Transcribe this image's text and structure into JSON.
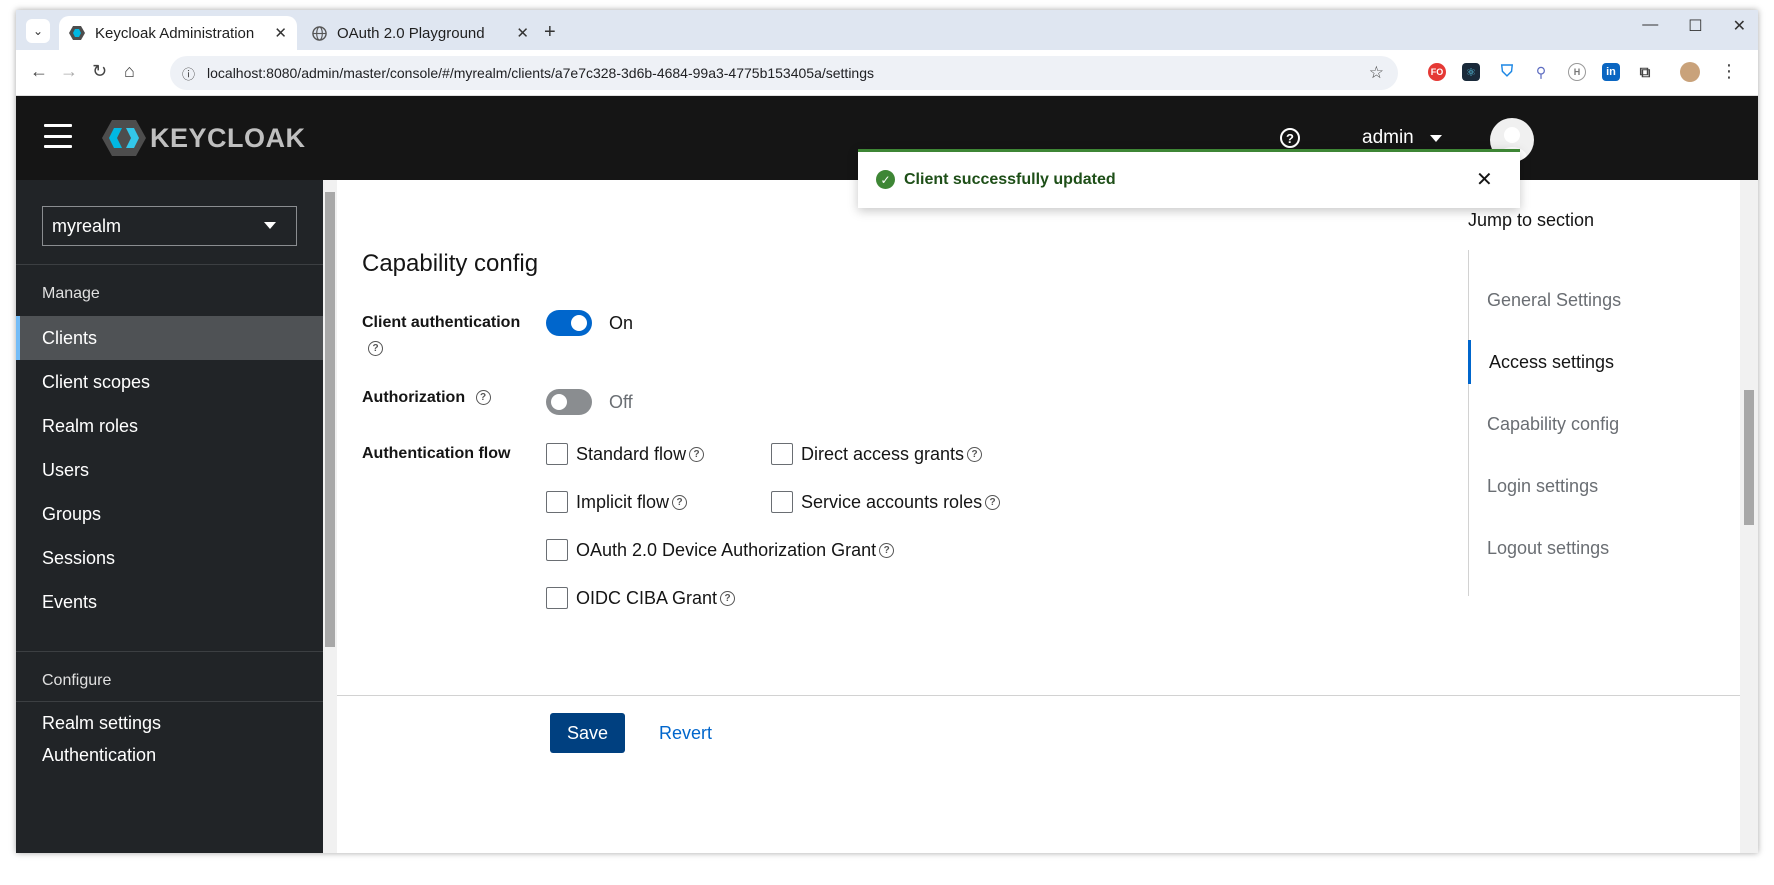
{
  "browser": {
    "tabs": [
      {
        "title": "Keycloak Administration",
        "active": true
      },
      {
        "title": "OAuth 2.0 Playground",
        "active": false
      }
    ],
    "url": "localhost:8080/admin/master/console/#/myrealm/clients/a7e7c328-3d6b-4684-99a3-4775b153405a/settings",
    "extensions": [
      "FO",
      "react-icon",
      "shield-icon",
      "share-icon",
      "H",
      "in",
      "puzzle-icon"
    ]
  },
  "header": {
    "logo": "KEYCLOAK",
    "user": "admin"
  },
  "sidebar": {
    "realm": "myrealm",
    "manage_label": "Manage",
    "items": [
      {
        "label": "Clients",
        "active": true
      },
      {
        "label": "Client scopes"
      },
      {
        "label": "Realm roles"
      },
      {
        "label": "Users"
      },
      {
        "label": "Groups"
      },
      {
        "label": "Sessions"
      },
      {
        "label": "Events"
      }
    ],
    "configure_label": "Configure",
    "configure_items": [
      {
        "label": "Realm settings"
      },
      {
        "label": "Authentication"
      }
    ]
  },
  "main": {
    "section_title": "Capability config",
    "client_auth": {
      "label": "Client authentication",
      "state": "On"
    },
    "authorization": {
      "label": "Authorization",
      "state": "Off"
    },
    "auth_flow": {
      "label": "Authentication flow",
      "options": [
        {
          "label": "Standard flow",
          "checked": false
        },
        {
          "label": "Direct access grants",
          "checked": false
        },
        {
          "label": "Implicit flow",
          "checked": false
        },
        {
          "label": "Service accounts roles",
          "checked": false
        },
        {
          "label": "OAuth 2.0 Device Authorization Grant",
          "checked": false
        },
        {
          "label": "OIDC CIBA Grant",
          "checked": false
        }
      ]
    },
    "save_label": "Save",
    "revert_label": "Revert"
  },
  "jump": {
    "title": "Jump to section",
    "items": [
      {
        "label": "General Settings"
      },
      {
        "label": "Access settings",
        "active": true
      },
      {
        "label": "Capability config"
      },
      {
        "label": "Login settings"
      },
      {
        "label": "Logout settings"
      }
    ]
  },
  "toast": {
    "message": "Client successfully updated"
  },
  "colors": {
    "accent": "#0066cc",
    "success": "#3e8635",
    "sidebar": "#212427",
    "header": "#151515"
  }
}
